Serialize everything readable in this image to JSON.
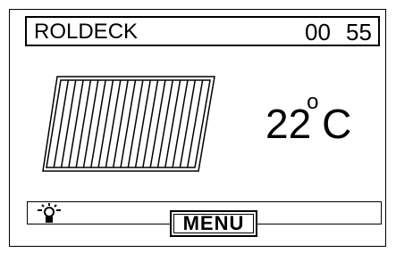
{
  "header": {
    "title": "ROLDECK",
    "time_hours": "00",
    "time_minutes": "55"
  },
  "display": {
    "temperature_value": "22",
    "temperature_degree": "o",
    "temperature_unit": "C"
  },
  "footer": {
    "menu_label": "MENU",
    "light_icon": "light-bulb-icon"
  },
  "shutter_icon": "roll-cover-icon",
  "colors": {
    "foreground": "#000000",
    "background": "#ffffff"
  }
}
